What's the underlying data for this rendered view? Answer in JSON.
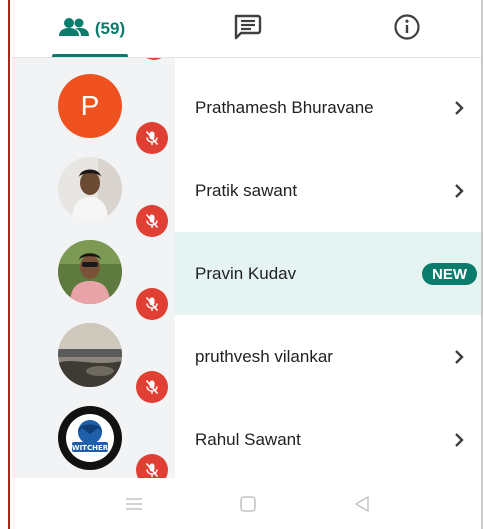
{
  "tabs": {
    "people": {
      "icon": "people-icon",
      "count": "(59)",
      "selected": true
    },
    "chat": {
      "icon": "chat-icon"
    },
    "info": {
      "icon": "info-icon"
    }
  },
  "participants": [
    {
      "name": "Prathamesh Bhuravane",
      "avatar": {
        "type": "letter",
        "letter": "P",
        "color": "#f0521f"
      },
      "muted": true,
      "action": "chevron-right-icon"
    },
    {
      "name": "Pratik sawant",
      "avatar": {
        "type": "photo"
      },
      "muted": true,
      "action": "chevron-right-icon"
    },
    {
      "name": "Pravin Kudav",
      "avatar": {
        "type": "photo"
      },
      "muted": true,
      "badge": "NEW",
      "highlighted": true
    },
    {
      "name": "pruthvesh vilankar",
      "avatar": {
        "type": "photo"
      },
      "muted": true,
      "action": "chevron-right-icon"
    },
    {
      "name": "Rahul Sawant",
      "avatar": {
        "type": "logo",
        "text": "WITCHER"
      },
      "muted": true,
      "action": "chevron-right-icon"
    }
  ],
  "navbar": {
    "items": [
      "menu-icon",
      "home-square-icon",
      "back-triangle-icon"
    ]
  },
  "colors": {
    "accent": "#0b7b6b",
    "mute_red": "#e03f33",
    "highlight": "#e6f4f1"
  }
}
